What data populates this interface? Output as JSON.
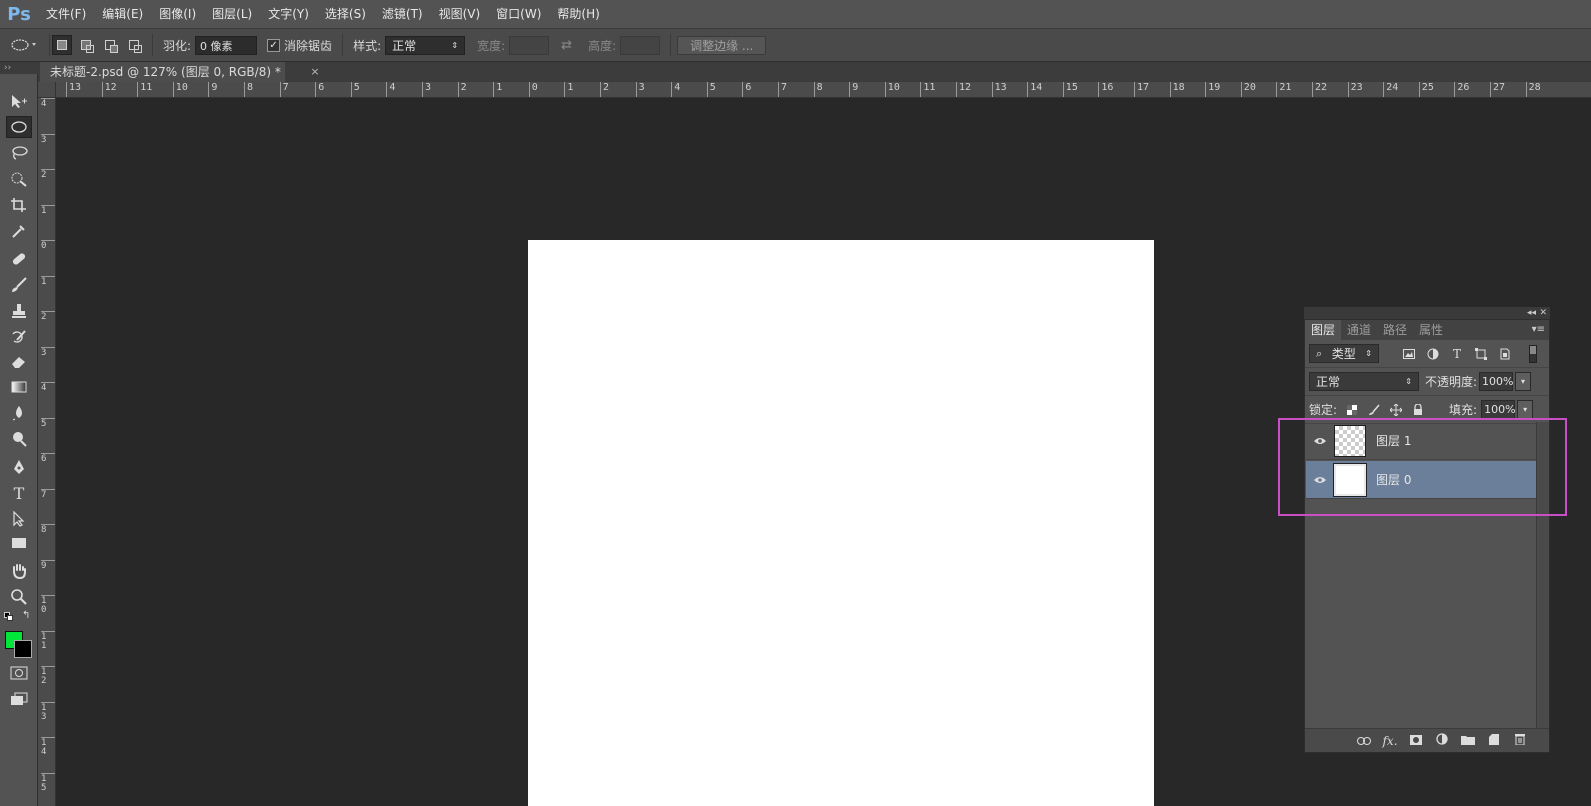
{
  "app": {
    "logo": "Ps",
    "menu": [
      "文件(F)",
      "编辑(E)",
      "图像(I)",
      "图层(L)",
      "文字(Y)",
      "选择(S)",
      "滤镜(T)",
      "视图(V)",
      "窗口(W)",
      "帮助(H)"
    ]
  },
  "options": {
    "feather_label": "羽化:",
    "feather_value": "0 像素",
    "antialias_label": "消除锯齿",
    "antialias_checked": "✓",
    "style_label": "样式:",
    "style_value": "正常",
    "width_label": "宽度:",
    "height_label": "高度:",
    "refine_button": "调整边缘 ..."
  },
  "document": {
    "tab_title": "未标题-2.psd @ 127% (图层 0, RGB/8) *",
    "close_glyph": "×"
  },
  "ruler": {
    "top_labels": [
      "13",
      "12",
      "11",
      "10",
      "9",
      "8",
      "7",
      "6",
      "5",
      "4",
      "3",
      "2",
      "1",
      "0",
      "1",
      "2",
      "3",
      "4",
      "5",
      "6",
      "7",
      "8",
      "9",
      "10",
      "11",
      "12",
      "13",
      "14",
      "15",
      "16",
      "17",
      "18",
      "19",
      "20",
      "21",
      "22",
      "23",
      "24",
      "25",
      "26",
      "27",
      "28"
    ],
    "left_labels": [
      "4",
      "3",
      "2",
      "1",
      "0",
      "1",
      "2",
      "3",
      "4",
      "5",
      "6",
      "7",
      "8",
      "9",
      "10",
      "11",
      "12",
      "13",
      "14",
      "15"
    ]
  },
  "layers_panel": {
    "tabs": [
      "图层",
      "通道",
      "路径",
      "属性"
    ],
    "filter_type": "类型",
    "blend_mode": "正常",
    "opacity_label": "不透明度:",
    "opacity_value": "100%",
    "lock_label": "锁定:",
    "fill_label": "填充:",
    "fill_value": "100%",
    "layers": [
      {
        "name": "图层 1",
        "selected": false
      },
      {
        "name": "图层 0",
        "selected": true
      }
    ]
  },
  "colors": {
    "foreground": "#00e639",
    "background": "#000000",
    "highlight": "#c84fc8",
    "selected_layer": "#6b7f9a"
  },
  "icons": {
    "eye": "eye-icon",
    "link": "link-icon",
    "fx": "fx-icon",
    "mask": "mask-icon",
    "adjustment": "adjustment-icon",
    "folder": "folder-icon",
    "new_layer": "new-layer-icon",
    "trash": "trash-icon"
  }
}
